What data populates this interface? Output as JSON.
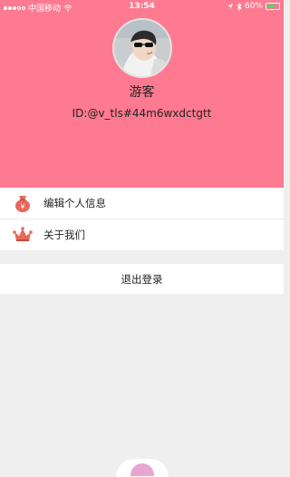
{
  "status_bar": {
    "carrier": "中国移动",
    "time": "13:54",
    "battery": "60%"
  },
  "profile": {
    "name": "游客",
    "id_text": "ID:@v_tls#44m6wxdctgtt"
  },
  "menu": {
    "items": [
      {
        "label": "编辑个人信息",
        "icon": "money-bag-icon"
      },
      {
        "label": "关于我们",
        "icon": "crown-icon"
      }
    ]
  },
  "logout": {
    "label": "退出登录"
  },
  "colors": {
    "header_bg": "#fe7a90",
    "page_bg": "#efefef"
  }
}
